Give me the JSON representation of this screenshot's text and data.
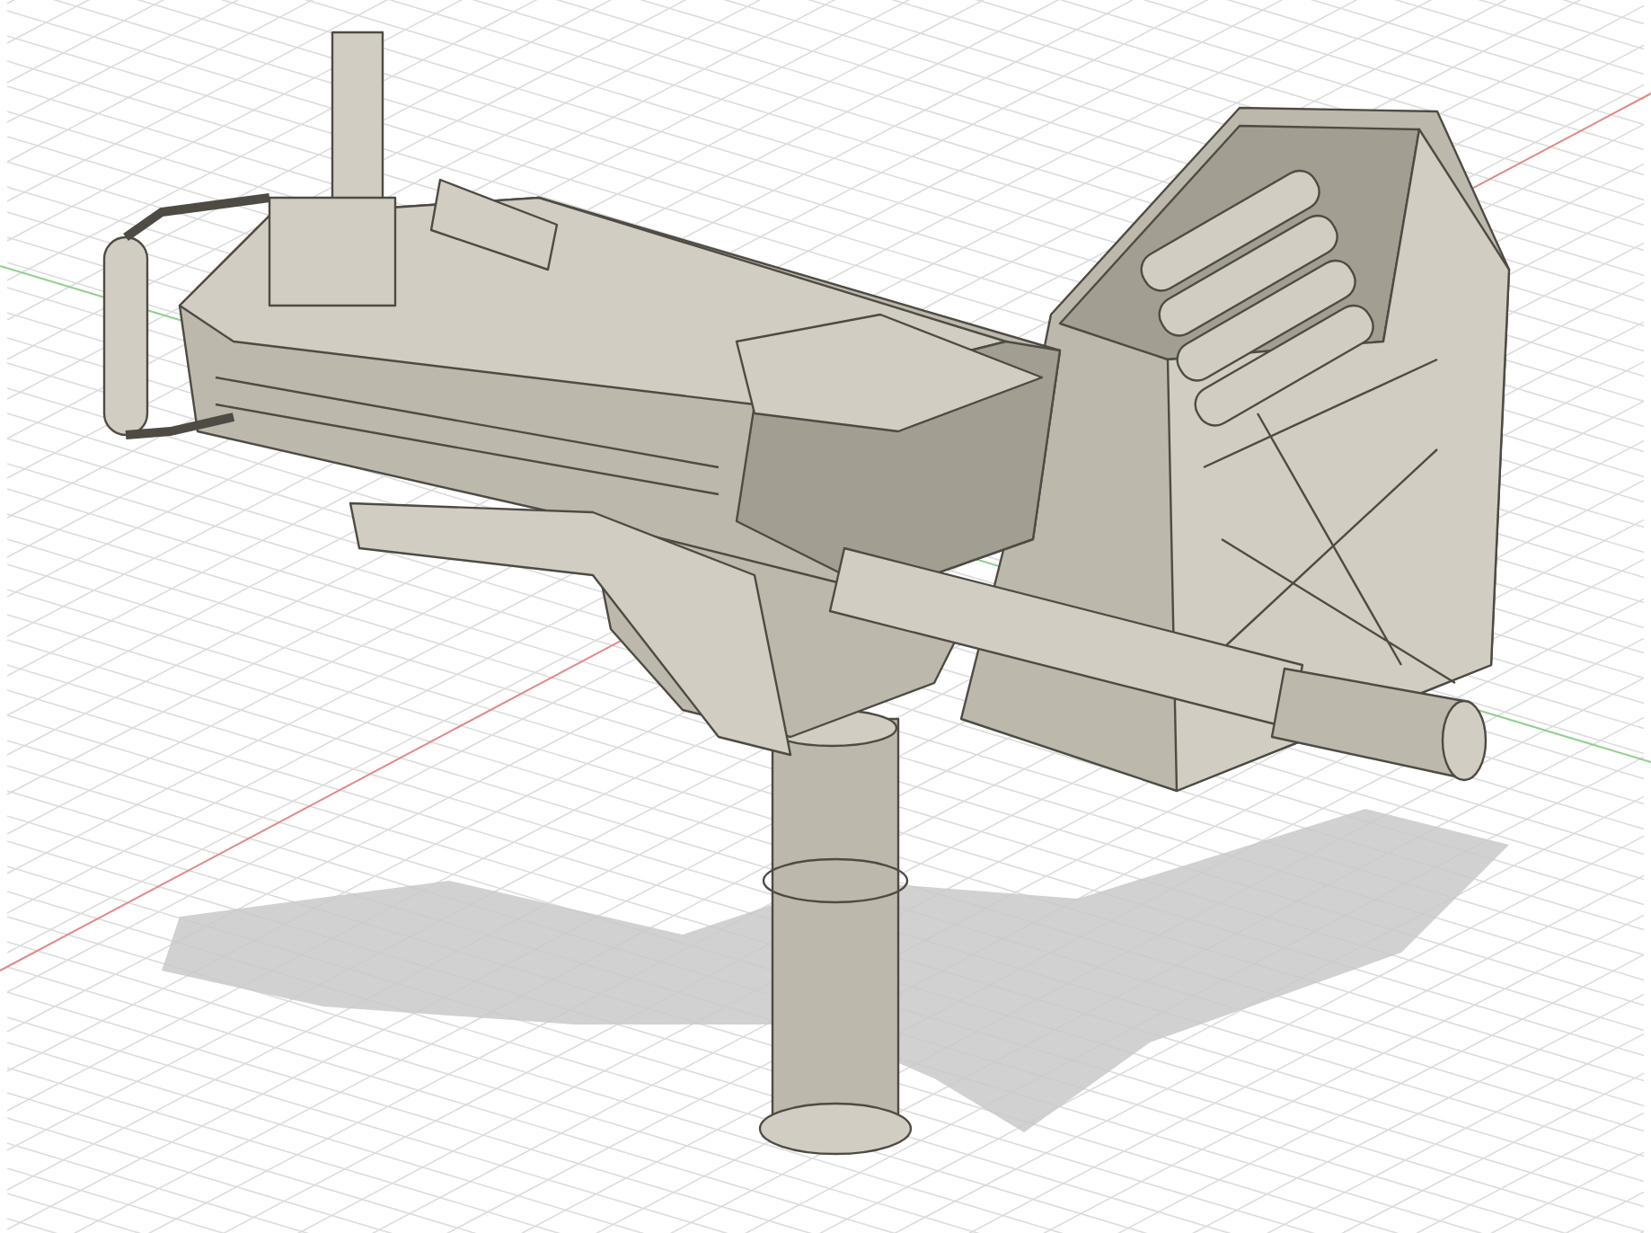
{
  "viewport": {
    "kind": "perspective-grid"
  }
}
